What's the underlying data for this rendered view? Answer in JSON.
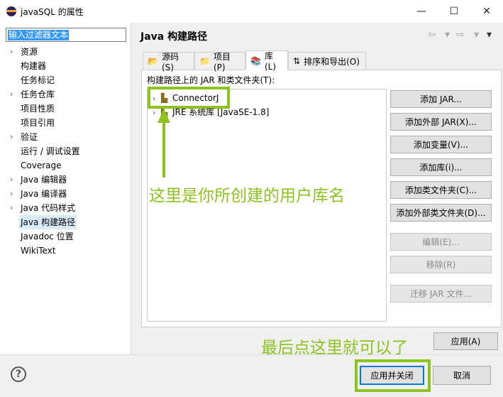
{
  "window": {
    "title": "javaSQL 的属性",
    "minimize": "—",
    "maximize": "☐",
    "close": "✕"
  },
  "filter": {
    "value": "输入过滤器文本"
  },
  "sidebar": {
    "items": [
      {
        "label": "资源",
        "chevron": "›"
      },
      {
        "label": "构建器",
        "chevron": ""
      },
      {
        "label": "任务标记",
        "chevron": ""
      },
      {
        "label": "任务仓库",
        "chevron": "›"
      },
      {
        "label": "项目性质",
        "chevron": ""
      },
      {
        "label": "项目引用",
        "chevron": ""
      },
      {
        "label": "验证",
        "chevron": "›"
      },
      {
        "label": "运行 / 调试设置",
        "chevron": ""
      },
      {
        "label": "Coverage",
        "chevron": ""
      },
      {
        "label": "Java 编辑器",
        "chevron": "›"
      },
      {
        "label": "Java 编译器",
        "chevron": "›"
      },
      {
        "label": "Java 代码样式",
        "chevron": "›"
      },
      {
        "label": "Java 构建路径",
        "chevron": ""
      },
      {
        "label": "Javadoc 位置",
        "chevron": ""
      },
      {
        "label": "WikiText",
        "chevron": ""
      }
    ]
  },
  "page": {
    "title": "Java 构建路径",
    "nav_back": "⇦",
    "nav_drop": "▾",
    "nav_forward": "⇨",
    "nav_menu": "▾"
  },
  "tabs": [
    {
      "label": "源码(S)",
      "icon": "📂"
    },
    {
      "label": "项目(P)",
      "icon": "📁"
    },
    {
      "label": "库(L)",
      "icon": "📚"
    },
    {
      "label": "排序和导出(O)",
      "icon": "⇅"
    }
  ],
  "libraries": {
    "label": "构建路径上的 JAR 和类文件夹(T):",
    "items": [
      {
        "label": "ConnectorJ",
        "chevron": "›",
        "icon": "▙"
      },
      {
        "label": "JRE 系统库 [JavaSE-1.8]",
        "chevron": "›",
        "icon": "▙"
      }
    ]
  },
  "buttons": {
    "add_jar": "添加 JAR...",
    "add_external_jar": "添加外部 JAR(X)...",
    "add_variable": "添加变量(V)...",
    "add_library": "添加库(i)...",
    "add_class_folder": "添加类文件夹(C)...",
    "add_external_class_folder": "添加外部类文件夹(D)...",
    "edit": "编辑(E)...",
    "remove": "移除(R)",
    "migrate_jar": "迁移 JAR 文件...",
    "apply": "应用(A)",
    "apply_close": "应用并关闭",
    "cancel": "取消",
    "help": "?"
  },
  "annotations": {
    "library_note": "这里是你所创建的用户库名",
    "apply_note": "最后点这里就可以了"
  },
  "colors": {
    "annotation": "#8dc21f",
    "selection": "#3399ff",
    "selected_row": "#d9ebf9"
  }
}
